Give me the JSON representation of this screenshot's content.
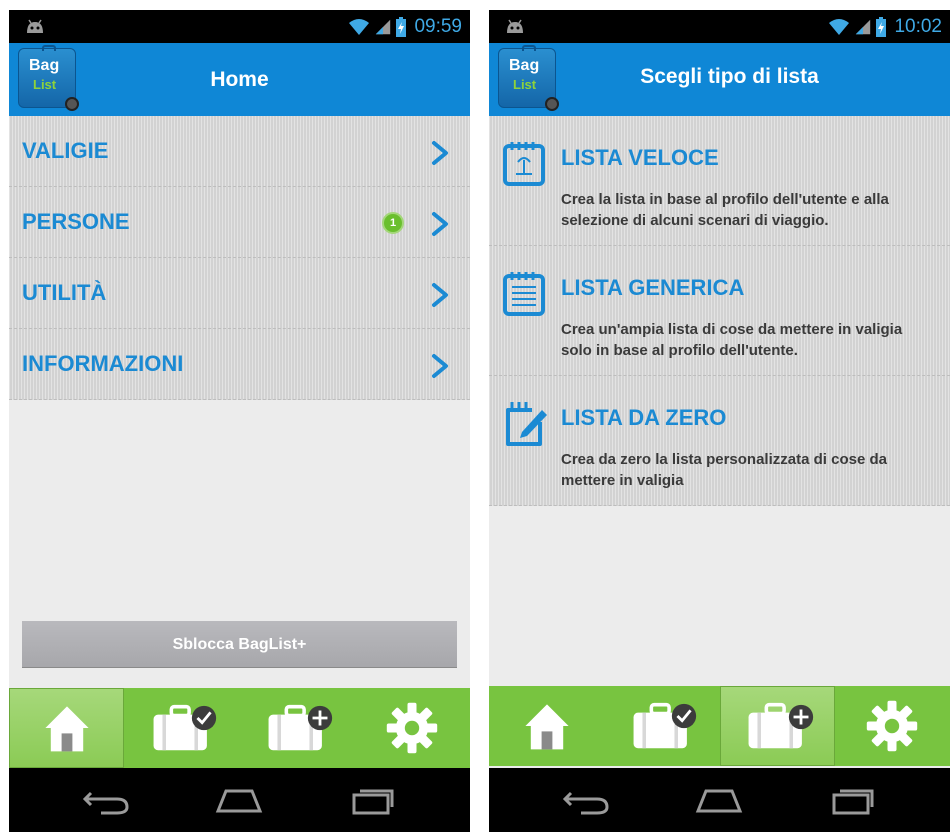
{
  "left_screen": {
    "status": {
      "time": "09:59"
    },
    "header": {
      "title": "Home",
      "logo_top": "Bag",
      "logo_bottom": "List"
    },
    "menu": [
      {
        "label": "VALIGIE"
      },
      {
        "label": "PERSONE",
        "badge": "1"
      },
      {
        "label": "UTILITÀ"
      },
      {
        "label": "INFORMAZIONI"
      }
    ],
    "unlock_button": "Sblocca BagList+",
    "tabs": [
      {
        "icon": "home-icon",
        "active": true
      },
      {
        "icon": "suitcase-check-icon"
      },
      {
        "icon": "suitcase-add-icon"
      },
      {
        "icon": "gear-icon"
      }
    ]
  },
  "right_screen": {
    "status": {
      "time": "10:02"
    },
    "header": {
      "title": "Scegli tipo di lista",
      "logo_top": "Bag",
      "logo_bottom": "List"
    },
    "options": [
      {
        "icon": "calendar-quick-icon",
        "title": "LISTA VELOCE",
        "description": "Crea la lista in base al profilo dell'utente e alla selezione di alcuni scenari di viaggio."
      },
      {
        "icon": "notepad-lines-icon",
        "title": "LISTA GENERICA",
        "description": "Crea un'ampia lista di cose da mettere in valigia solo in base al profilo dell'utente."
      },
      {
        "icon": "notepad-pencil-icon",
        "title": "LISTA DA ZERO",
        "description": "Crea da zero la lista personalizzata di cose da mettere in valigia"
      }
    ],
    "tabs": [
      {
        "icon": "home-icon"
      },
      {
        "icon": "suitcase-check-icon"
      },
      {
        "icon": "suitcase-add-icon",
        "active": true
      },
      {
        "icon": "gear-icon"
      }
    ]
  },
  "colors": {
    "accent": "#0f87d6",
    "link_text": "#1b8ad3",
    "tabbar": "#78c440",
    "badge": "#6abf2e",
    "clock": "#3fa9e5"
  }
}
